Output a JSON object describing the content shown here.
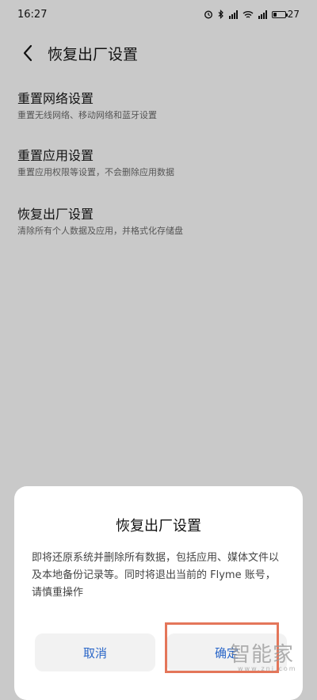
{
  "status_bar": {
    "time": "16:27",
    "battery_level": "27"
  },
  "header": {
    "title": "恢复出厂设置"
  },
  "settings": [
    {
      "title": "重置网络设置",
      "description": "重置无线网络、移动网络和蓝牙设置"
    },
    {
      "title": "重置应用设置",
      "description": "重置应用权限等设置，不会删除应用数据"
    },
    {
      "title": "恢复出厂设置",
      "description": "清除所有个人数据及应用，并格式化存储盘"
    }
  ],
  "dialog": {
    "title": "恢复出厂设置",
    "message": "即将还原系统并删除所有数据，包括应用、媒体文件以及本地备份记录等。同时将退出当前的 Flyme 账号，请慎重操作",
    "cancel_label": "取消",
    "confirm_label": "确定"
  },
  "watermark": {
    "text": "智能家",
    "sub": "www.znj.com"
  },
  "colors": {
    "background": "#c9c9c9",
    "accent": "#2a66c8",
    "highlight": "#e4765a"
  }
}
